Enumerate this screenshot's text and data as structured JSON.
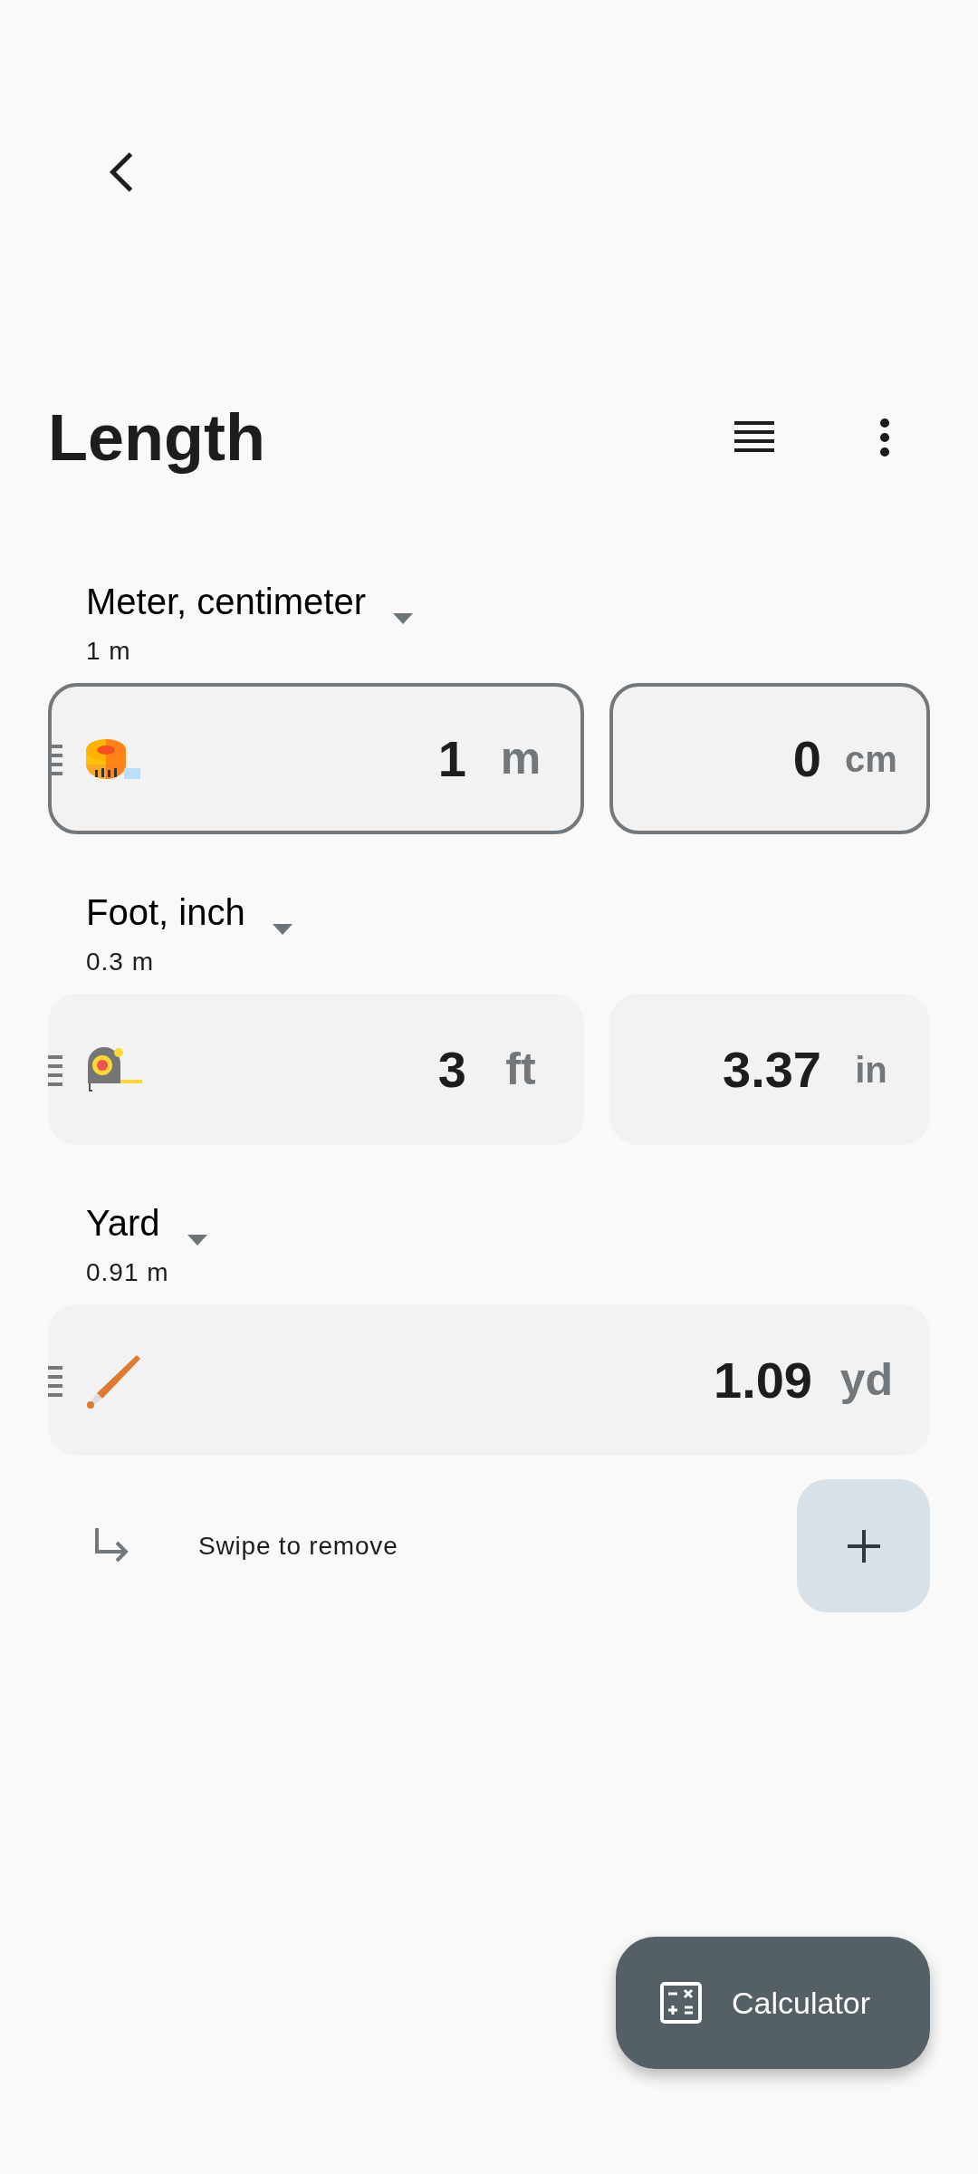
{
  "title": "Length",
  "groups": [
    {
      "name": "Meter, centimeter",
      "subtitle": "1 m",
      "fields": [
        {
          "value": "1",
          "unit": "m",
          "focused": true
        },
        {
          "value": "0",
          "unit": "cm",
          "focused": true
        }
      ]
    },
    {
      "name": "Foot, inch",
      "subtitle": "0.3 m",
      "fields": [
        {
          "value": "3",
          "unit": "ft",
          "focused": false
        },
        {
          "value": "3.37",
          "unit": "in",
          "focused": false
        }
      ]
    },
    {
      "name": "Yard",
      "subtitle": "0.91 m",
      "fields": [
        {
          "value": "1.09",
          "unit": "yd",
          "focused": false
        }
      ]
    }
  ],
  "hint": "Swipe to remove",
  "calculator_button": "Calculator"
}
